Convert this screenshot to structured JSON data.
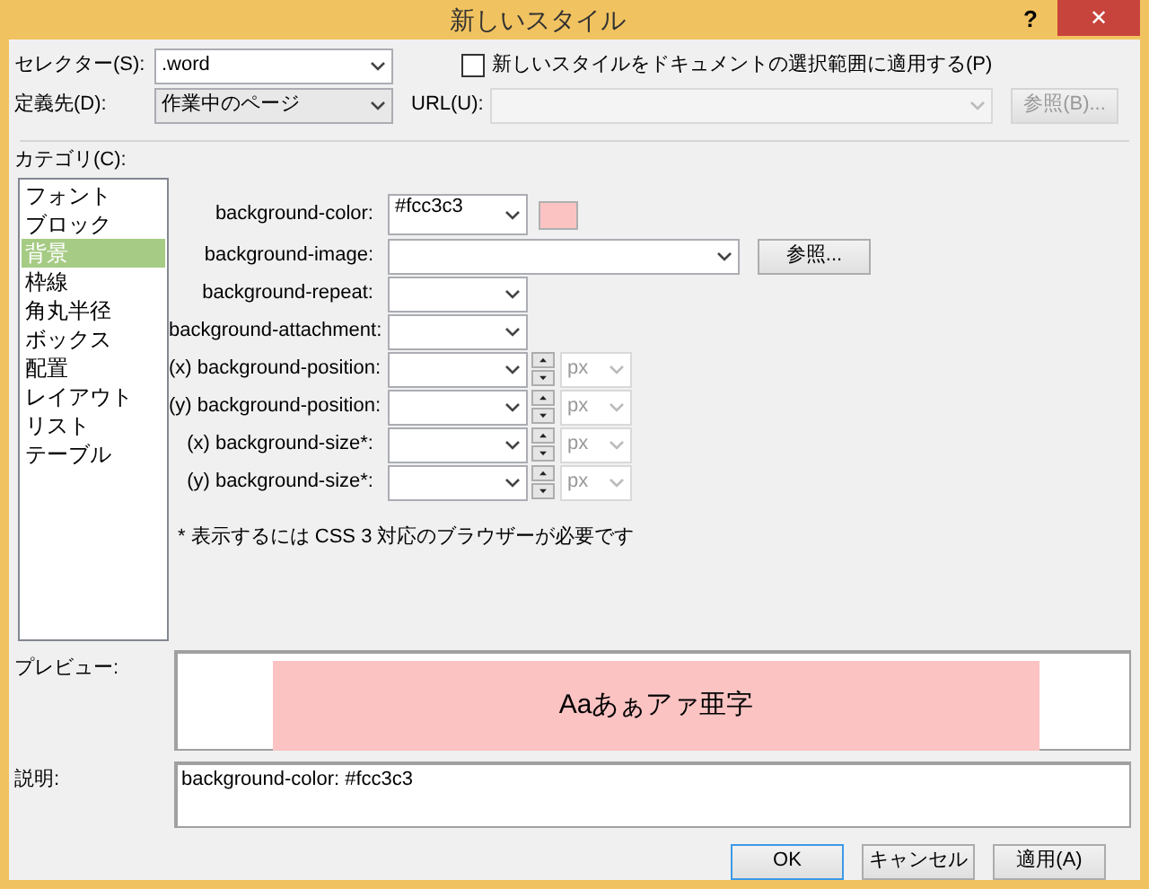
{
  "window": {
    "title": "新しいスタイル",
    "help": "?",
    "close": "✕"
  },
  "selector": {
    "label": "セレクター(S):",
    "value": ".word"
  },
  "apply_checkbox": {
    "label": "新しいスタイルをドキュメントの選択範囲に適用する(P)",
    "checked": false
  },
  "define_in": {
    "label": "定義先(D):",
    "value": "作業中のページ"
  },
  "url": {
    "label": "URL(U):",
    "disabled": true
  },
  "url_browse": {
    "label": "参照(B)...",
    "disabled": true
  },
  "category": {
    "label": "カテゴリ(C):",
    "items": [
      {
        "label": "フォント",
        "selected": false
      },
      {
        "label": "ブロック",
        "selected": false
      },
      {
        "label": "背景",
        "selected": true
      },
      {
        "label": "枠線",
        "selected": false
      },
      {
        "label": "角丸半径",
        "selected": false
      },
      {
        "label": "ボックス",
        "selected": false
      },
      {
        "label": "配置",
        "selected": false
      },
      {
        "label": "レイアウト",
        "selected": false
      },
      {
        "label": "リスト",
        "selected": false
      },
      {
        "label": "テーブル",
        "selected": false
      }
    ]
  },
  "properties": [
    {
      "kind": "color",
      "label": "background-color:",
      "value": "#fcc3c3"
    },
    {
      "kind": "image",
      "label": "background-image:",
      "button": "参照..."
    },
    {
      "kind": "select",
      "label": "background-repeat:"
    },
    {
      "kind": "select",
      "label": "background-attachment:"
    },
    {
      "kind": "spin",
      "label": "(x) background-position:",
      "unit": "px"
    },
    {
      "kind": "spin",
      "label": "(y) background-position:",
      "unit": "px"
    },
    {
      "kind": "spin",
      "label": "(x) background-size*:",
      "unit": "px"
    },
    {
      "kind": "spin",
      "label": "(y) background-size*:",
      "unit": "px"
    }
  ],
  "note": "* 表示するには CSS 3 対応のブラウザーが必要です",
  "preview": {
    "label": "プレビュー:",
    "sample": "Aaあぁアァ亜字"
  },
  "description": {
    "label": "説明:",
    "text": "background-color: #fcc3c3"
  },
  "buttons": [
    {
      "label": "OK",
      "default": true
    },
    {
      "label": "キャンセル",
      "default": false
    },
    {
      "label": "適用(A)",
      "default": false
    }
  ]
}
